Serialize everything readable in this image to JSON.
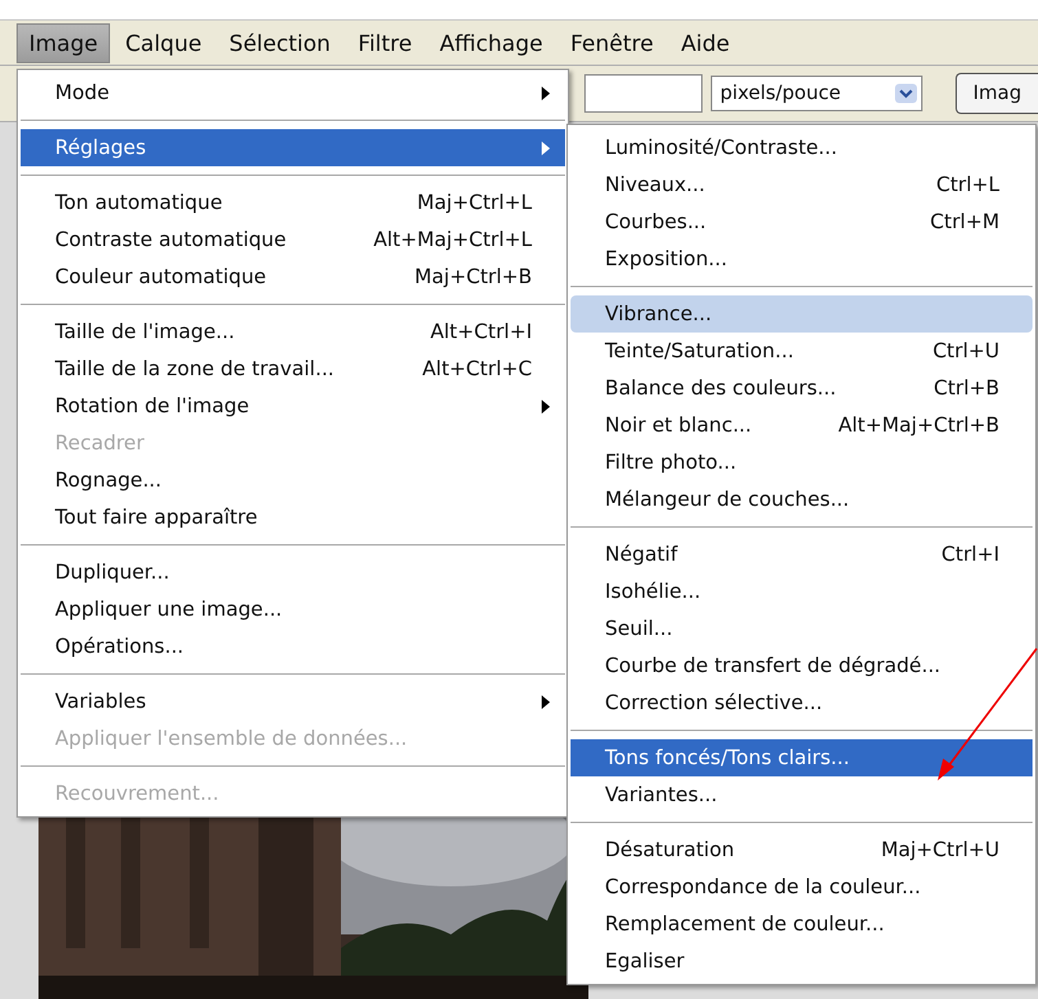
{
  "menu_bar": [
    {
      "label": "Image",
      "selected": true
    },
    {
      "label": "Calque",
      "selected": false
    },
    {
      "label": "Sélection",
      "selected": false
    },
    {
      "label": "Filtre",
      "selected": false
    },
    {
      "label": "Affichage",
      "selected": false
    },
    {
      "label": "Fenêtre",
      "selected": false
    },
    {
      "label": "Aide",
      "selected": false
    }
  ],
  "options_bar": {
    "resolution_unit": "pixels/pouce",
    "button": "Imag"
  },
  "image_menu": [
    {
      "kind": "item",
      "label": "Mode",
      "has_submenu": true,
      "disabled": false,
      "selected": false
    },
    {
      "kind": "separator"
    },
    {
      "kind": "item",
      "label": "Réglages",
      "has_submenu": true,
      "disabled": false,
      "selected": true
    },
    {
      "kind": "separator"
    },
    {
      "kind": "item",
      "label": "Ton automatique",
      "shortcut": "Maj+Ctrl+L",
      "has_submenu": false,
      "disabled": false,
      "selected": false
    },
    {
      "kind": "item",
      "label": "Contraste automatique",
      "shortcut": "Alt+Maj+Ctrl+L",
      "has_submenu": false,
      "disabled": false,
      "selected": false
    },
    {
      "kind": "item",
      "label": "Couleur automatique",
      "shortcut": "Maj+Ctrl+B",
      "has_submenu": false,
      "disabled": false,
      "selected": false
    },
    {
      "kind": "separator"
    },
    {
      "kind": "item",
      "label": "Taille de l'image...",
      "shortcut": "Alt+Ctrl+I",
      "has_submenu": false,
      "disabled": false,
      "selected": false
    },
    {
      "kind": "item",
      "label": "Taille de la zone de travail...",
      "shortcut": "Alt+Ctrl+C",
      "has_submenu": false,
      "disabled": false,
      "selected": false
    },
    {
      "kind": "item",
      "label": "Rotation de l'image",
      "has_submenu": true,
      "disabled": false,
      "selected": false
    },
    {
      "kind": "item",
      "label": "Recadrer",
      "has_submenu": false,
      "disabled": true,
      "selected": false
    },
    {
      "kind": "item",
      "label": "Rognage...",
      "has_submenu": false,
      "disabled": false,
      "selected": false
    },
    {
      "kind": "item",
      "label": "Tout faire apparaître",
      "has_submenu": false,
      "disabled": false,
      "selected": false
    },
    {
      "kind": "separator"
    },
    {
      "kind": "item",
      "label": "Dupliquer...",
      "has_submenu": false,
      "disabled": false,
      "selected": false
    },
    {
      "kind": "item",
      "label": "Appliquer une image...",
      "has_submenu": false,
      "disabled": false,
      "selected": false
    },
    {
      "kind": "item",
      "label": "Opérations...",
      "has_submenu": false,
      "disabled": false,
      "selected": false
    },
    {
      "kind": "separator"
    },
    {
      "kind": "item",
      "label": "Variables",
      "has_submenu": true,
      "disabled": false,
      "selected": false
    },
    {
      "kind": "item",
      "label": "Appliquer l'ensemble de données...",
      "has_submenu": false,
      "disabled": true,
      "selected": false
    },
    {
      "kind": "separator"
    },
    {
      "kind": "item",
      "label": "Recouvrement...",
      "has_submenu": false,
      "disabled": true,
      "selected": false
    }
  ],
  "adjustments_menu": [
    {
      "kind": "item",
      "label": "Luminosité/Contraste...",
      "selected": false,
      "hovered": false
    },
    {
      "kind": "item",
      "label": "Niveaux...",
      "shortcut": "Ctrl+L",
      "selected": false,
      "hovered": false
    },
    {
      "kind": "item",
      "label": "Courbes...",
      "shortcut": "Ctrl+M",
      "selected": false,
      "hovered": false
    },
    {
      "kind": "item",
      "label": "Exposition...",
      "selected": false,
      "hovered": false
    },
    {
      "kind": "separator"
    },
    {
      "kind": "item",
      "label": "Vibrance...",
      "selected": false,
      "hovered": true
    },
    {
      "kind": "item",
      "label": "Teinte/Saturation...",
      "shortcut": "Ctrl+U",
      "selected": false,
      "hovered": false
    },
    {
      "kind": "item",
      "label": "Balance des couleurs...",
      "shortcut": "Ctrl+B",
      "selected": false,
      "hovered": false
    },
    {
      "kind": "item",
      "label": "Noir et blanc...",
      "shortcut": "Alt+Maj+Ctrl+B",
      "selected": false,
      "hovered": false
    },
    {
      "kind": "item",
      "label": "Filtre photo...",
      "selected": false,
      "hovered": false
    },
    {
      "kind": "item",
      "label": "Mélangeur de couches...",
      "selected": false,
      "hovered": false
    },
    {
      "kind": "separator"
    },
    {
      "kind": "item",
      "label": "Négatif",
      "shortcut": "Ctrl+I",
      "selected": false,
      "hovered": false
    },
    {
      "kind": "item",
      "label": "Isohélie...",
      "selected": false,
      "hovered": false
    },
    {
      "kind": "item",
      "label": "Seuil...",
      "selected": false,
      "hovered": false
    },
    {
      "kind": "item",
      "label": "Courbe de transfert de dégradé...",
      "selected": false,
      "hovered": false
    },
    {
      "kind": "item",
      "label": "Correction sélective...",
      "selected": false,
      "hovered": false
    },
    {
      "kind": "separator"
    },
    {
      "kind": "item",
      "label": "Tons foncés/Tons clairs...",
      "selected": true,
      "hovered": false
    },
    {
      "kind": "item",
      "label": "Variantes...",
      "selected": false,
      "hovered": false
    },
    {
      "kind": "separator"
    },
    {
      "kind": "item",
      "label": "Désaturation",
      "shortcut": "Maj+Ctrl+U",
      "selected": false,
      "hovered": false
    },
    {
      "kind": "item",
      "label": "Correspondance de la couleur...",
      "selected": false,
      "hovered": false
    },
    {
      "kind": "item",
      "label": "Remplacement de couleur...",
      "selected": false,
      "hovered": false
    },
    {
      "kind": "item",
      "label": "Egaliser",
      "selected": false,
      "hovered": false
    }
  ]
}
